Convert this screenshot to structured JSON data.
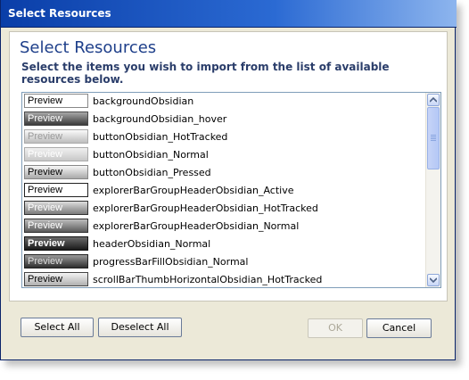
{
  "window": {
    "title": "Select Resources"
  },
  "header": {
    "title": "Select Resources",
    "description": "Select the items you wish to import from the list of available resources below."
  },
  "list": {
    "items": [
      {
        "preview": "Preview",
        "name": "backgroundObsidian"
      },
      {
        "preview": "Preview",
        "name": "backgroundObsidian_hover"
      },
      {
        "preview": "Preview",
        "name": "buttonObsidian_HotTracked"
      },
      {
        "preview": "Preview",
        "name": "buttonObsidian_Normal"
      },
      {
        "preview": "Preview",
        "name": "buttonObsidian_Pressed"
      },
      {
        "preview": "Preview",
        "name": "explorerBarGroupHeaderObsidian_Active"
      },
      {
        "preview": "Preview",
        "name": "explorerBarGroupHeaderObsidian_HotTracked"
      },
      {
        "preview": "Preview",
        "name": "explorerBarGroupHeaderObsidian_Normal"
      },
      {
        "preview": "Preview",
        "name": "headerObsidian_Normal"
      },
      {
        "preview": "Preview",
        "name": "progressBarFillObsidian_Normal"
      },
      {
        "preview": "Preview",
        "name": "scrollBarThumbHorizontalObsidian_HotTracked"
      }
    ]
  },
  "footer": {
    "select_all": "Select All",
    "deselect_all": "Deselect All",
    "ok": "OK",
    "cancel": "Cancel"
  },
  "colors": {
    "titlebar": "#0a3ea8",
    "heading": "#1e3f8a",
    "panel": "#ece9d8"
  }
}
